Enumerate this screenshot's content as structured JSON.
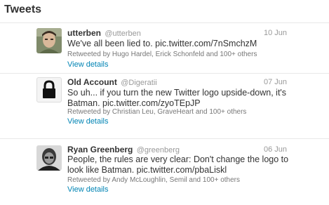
{
  "section_title": "Tweets",
  "tweets": [
    {
      "name": "utterben",
      "handle": "@utterben",
      "date": "10 Jun",
      "text": "We've all been lied to. pic.twitter.com/7nSmchzM",
      "retweeted_by": "Retweeted by Hugo Hardel, Erick Schonfeld and 100+ others",
      "details_label": "View details",
      "avatar_icon": "photo-avatar-icon"
    },
    {
      "name": "Old Account",
      "handle": "@Digeratii",
      "date": "07 Jun",
      "text": "So uh... if you turn the new Twitter logo upside-down, it's Batman. pic.twitter.com/zyoTEpJP",
      "retweeted_by": "Retweeted by Christian Leu, GraveHeart and 100+ others",
      "details_label": "View details",
      "avatar_icon": "lock-icon"
    },
    {
      "name": "Ryan Greenberg",
      "handle": "@greenberg",
      "date": "06 Jun",
      "text": "People, the rules are very clear: Don't change the logo to look like Batman. pic.twitter.com/pbaLiskl",
      "retweeted_by": "Retweeted by Andy McLoughlin, Semil and 100+ others",
      "details_label": "View details",
      "avatar_icon": "photo-avatar-icon"
    }
  ],
  "colors": {
    "link": "#0084b4",
    "text": "#333333",
    "muted": "#999999",
    "divider": "#e8e8e8"
  }
}
